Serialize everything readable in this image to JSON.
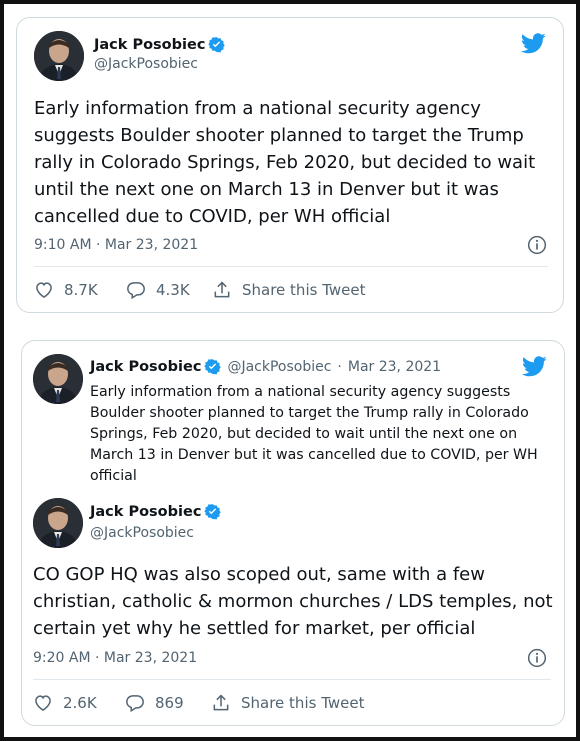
{
  "colors": {
    "accent": "#1d9bf0",
    "text": "#0f1419",
    "secondary": "#536471",
    "border": "#cfd9de",
    "frame": "#111111"
  },
  "icons": {
    "logo": "twitter-bird-icon",
    "verified": "verified-badge-icon",
    "info": "info-icon",
    "like": "heart-icon",
    "reply": "reply-bubble-icon",
    "share": "share-icon"
  },
  "tweet1": {
    "name": "Jack Posobiec",
    "handle": "@JackPosobiec",
    "text": "Early information from a national security agency suggests Boulder shooter planned to target the Trump rally in Colorado Springs, Feb 2020, but decided to wait until the next one on March 13 in Denver but it was cancelled due to COVID, per WH official",
    "time": "9:10 AM · Mar 23, 2021",
    "likes": "8.7K",
    "replies": "4.3K",
    "share_label": "Share this Tweet"
  },
  "tweet2": {
    "quoted": {
      "name": "Jack Posobiec",
      "handle": "@JackPosobiec",
      "date": "Mar 23, 2021",
      "text": "Early information from a national security agency suggests Boulder shooter planned to target the Trump rally in Colorado Springs, Feb 2020, but decided to wait until the next one on March 13 in Denver but it was cancelled due to COVID, per WH official"
    },
    "name": "Jack Posobiec",
    "handle": "@JackPosobiec",
    "text": "CO GOP HQ was also scoped out, same with a few christian, catholic & mormon churches / LDS temples, not certain yet why he settled for market, per official",
    "time": "9:20 AM · Mar 23, 2021",
    "likes": "2.6K",
    "replies": "869",
    "share_label": "Share this Tweet"
  }
}
